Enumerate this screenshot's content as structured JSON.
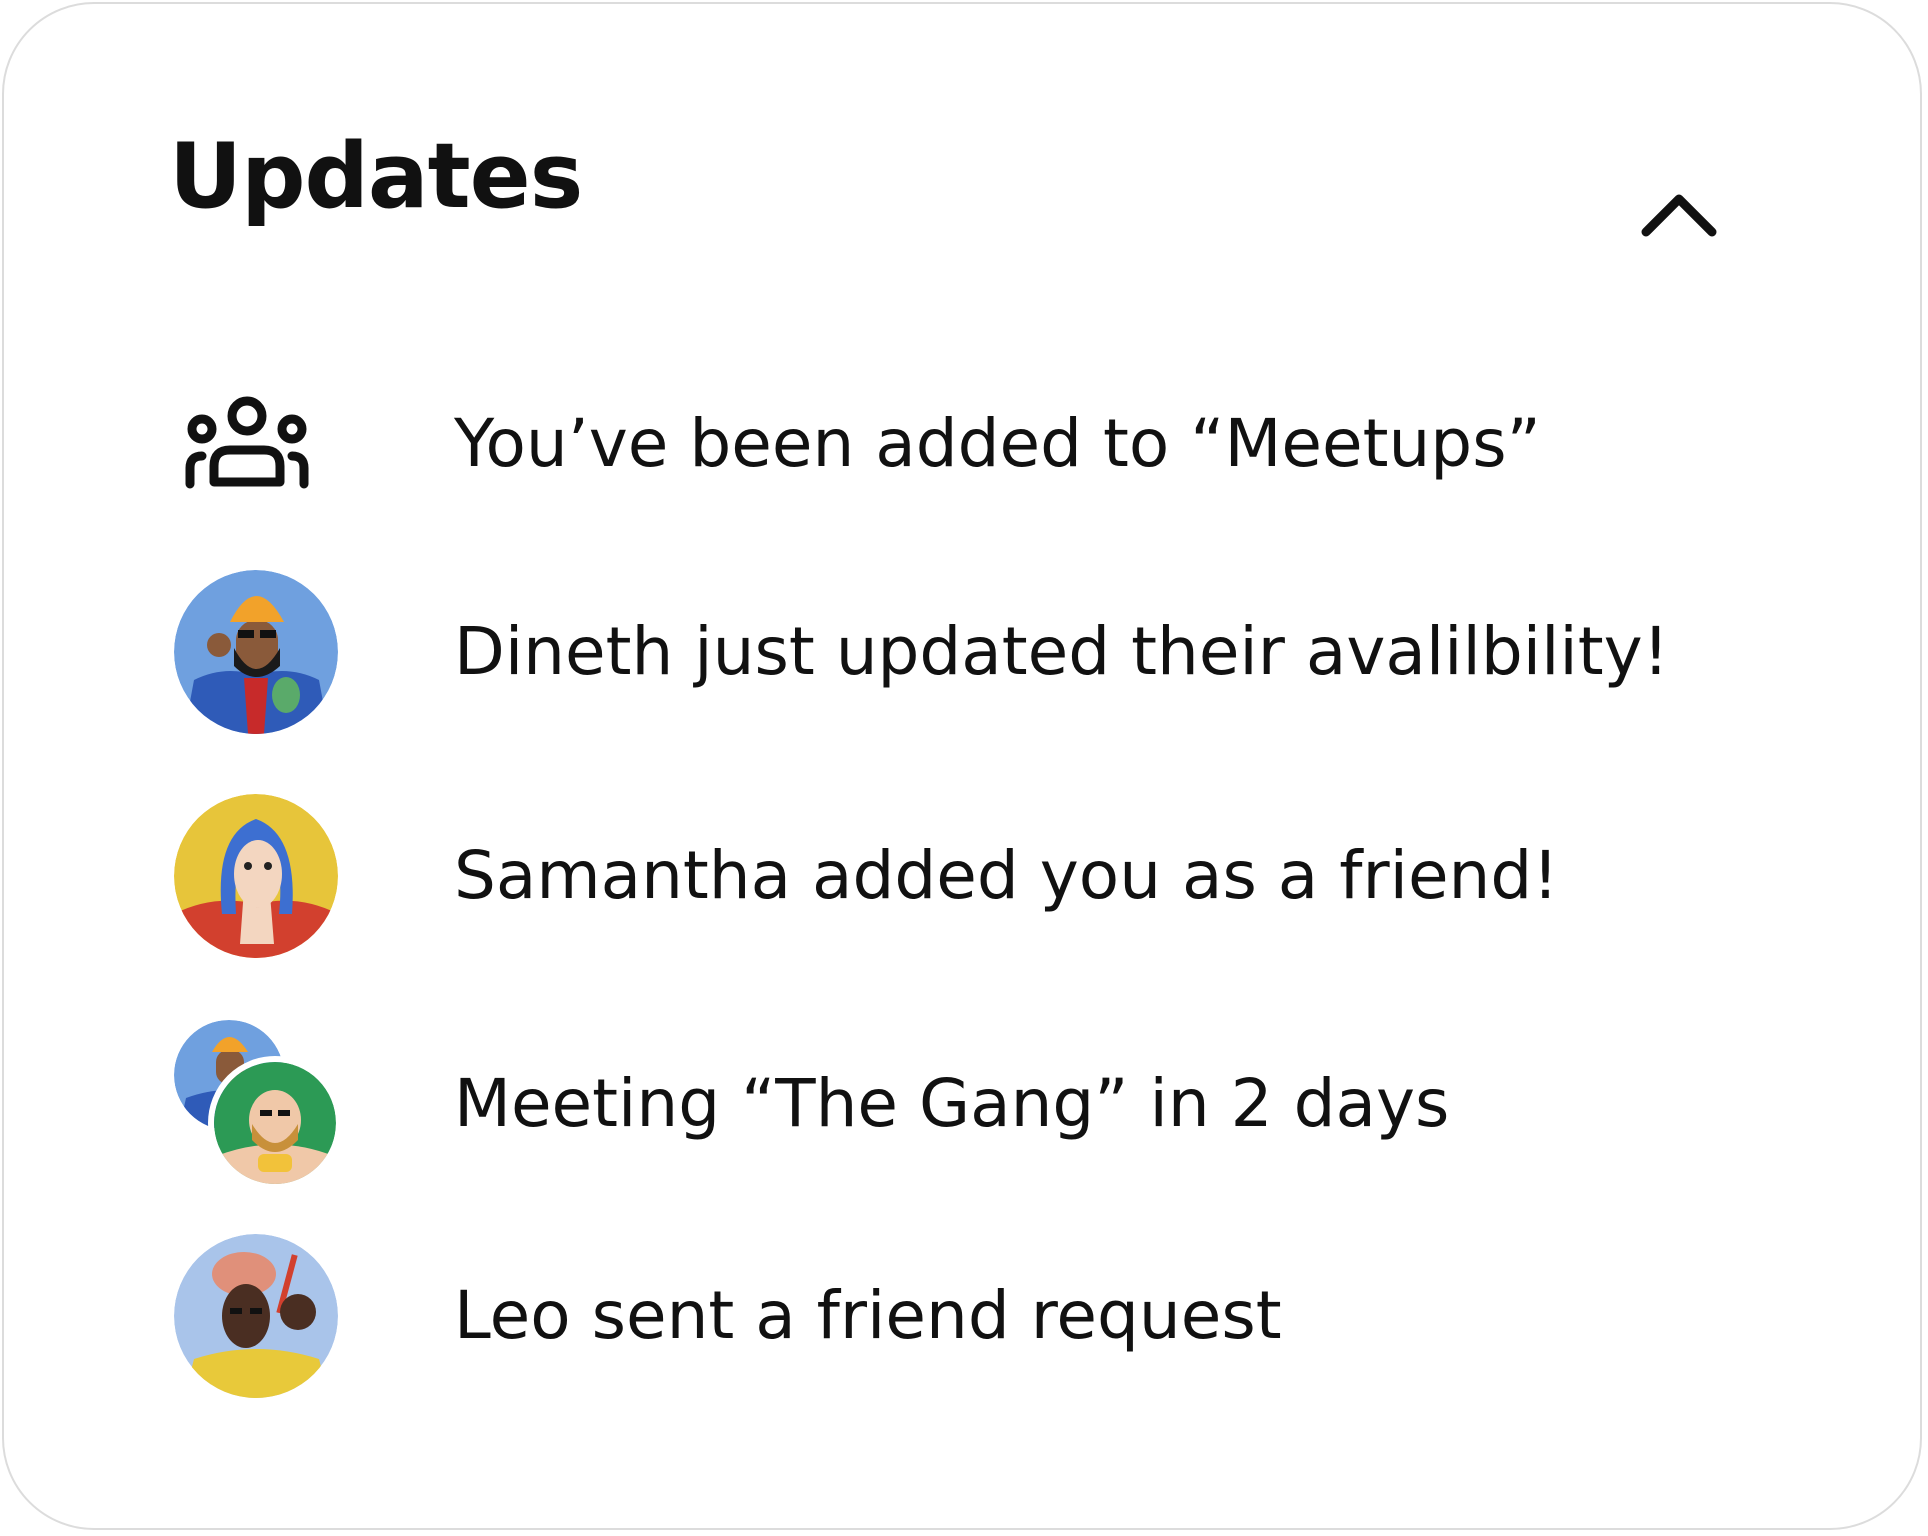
{
  "panel": {
    "title": "Updates",
    "collapse_icon": "chevron-up-icon"
  },
  "updates": [
    {
      "icon": "group-icon",
      "text": "You’ve been added to “Meetups”"
    },
    {
      "icon": "avatar-dineth",
      "text": "Dineth just updated their avalilbility!"
    },
    {
      "icon": "avatar-samantha",
      "text": "Samantha added you as a friend!"
    },
    {
      "icon": "avatar-group-the-gang",
      "text": "Meeting “The Gang” in 2 days"
    },
    {
      "icon": "avatar-leo",
      "text": "Leo sent a friend request"
    }
  ],
  "colors": {
    "text": "#111111",
    "border": "#dcdcdc",
    "background": "#ffffff"
  }
}
